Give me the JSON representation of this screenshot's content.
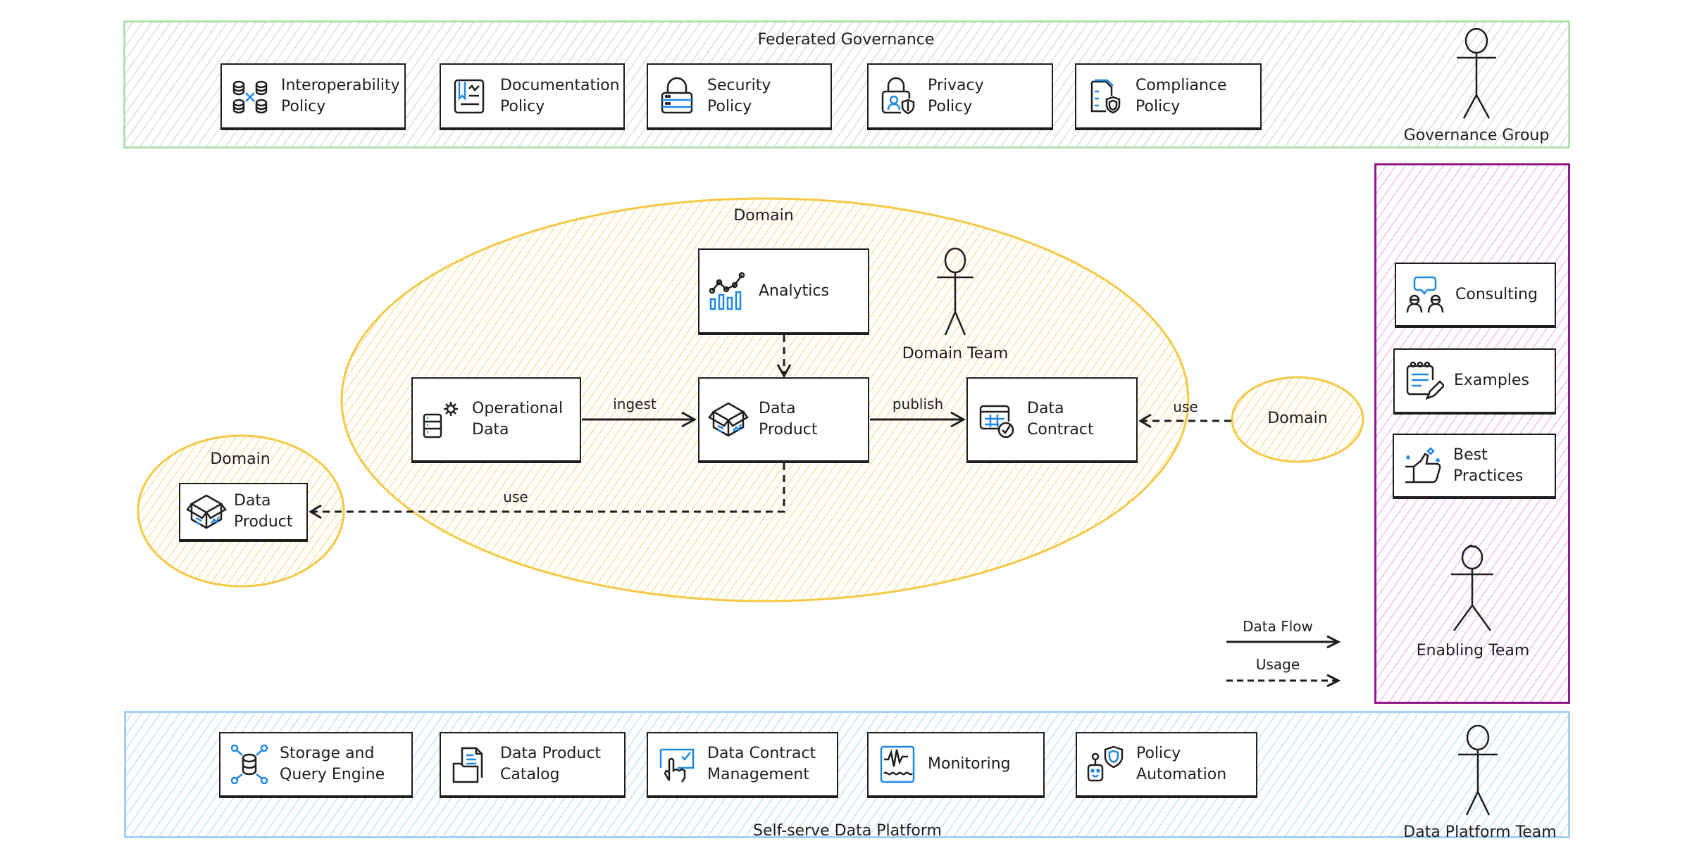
{
  "colors": {
    "governance_border": "#b2dfb0",
    "platform_border": "#a5d0f5",
    "enabling_border": "#8e1a8e",
    "domain_fill": "#fce9b1",
    "domain_border": "#f5c842",
    "icon_accent": "#1e88e5",
    "ink": "#1e1e1e"
  },
  "governance": {
    "title": "Federated Governance",
    "actor": "Governance Group",
    "policies": [
      {
        "label": "Interoperability\nPolicy",
        "icon": "interoperability-icon"
      },
      {
        "label": "Documentation\nPolicy",
        "icon": "documentation-icon"
      },
      {
        "label": "Security\nPolicy",
        "icon": "security-lock-icon"
      },
      {
        "label": "Privacy\nPolicy",
        "icon": "privacy-icon"
      },
      {
        "label": "Compliance\nPolicy",
        "icon": "compliance-icon"
      }
    ]
  },
  "domain": {
    "title": "Domain",
    "actor": "Domain Team",
    "nodes": {
      "analytics": {
        "label": "Analytics",
        "icon": "analytics-chart-icon"
      },
      "operational": {
        "label": "Operational\nData",
        "icon": "operational-data-icon"
      },
      "data_product": {
        "label": "Data\nProduct",
        "icon": "data-product-box-icon"
      },
      "data_contract": {
        "label": "Data\nContract",
        "icon": "data-contract-icon"
      }
    },
    "edges": {
      "ingest": "ingest",
      "publish": "publish",
      "use_right": "use",
      "use_left": "use"
    }
  },
  "left_domain": {
    "title": "Domain",
    "node": {
      "label": "Data\nProduct",
      "icon": "data-product-box-icon"
    }
  },
  "right_domain": {
    "title": "Domain"
  },
  "enabling": {
    "actor": "Enabling Team",
    "items": [
      {
        "label": "Consulting",
        "icon": "consulting-icon"
      },
      {
        "label": "Examples",
        "icon": "examples-notepad-icon"
      },
      {
        "label": "Best\nPractices",
        "icon": "best-practices-thumbs-up-icon"
      }
    ]
  },
  "legend": {
    "data_flow": "Data Flow",
    "usage": "Usage"
  },
  "platform": {
    "title": "Self-serve Data Platform",
    "actor": "Data Platform Team",
    "services": [
      {
        "label": "Storage and\nQuery Engine",
        "icon": "storage-database-icon"
      },
      {
        "label": "Data Product\nCatalog",
        "icon": "catalog-folder-icon"
      },
      {
        "label": "Data Contract\nManagement",
        "icon": "contract-management-icon"
      },
      {
        "label": "Monitoring",
        "icon": "monitoring-icon"
      },
      {
        "label": "Policy\nAutomation",
        "icon": "policy-automation-robot-icon"
      }
    ]
  }
}
